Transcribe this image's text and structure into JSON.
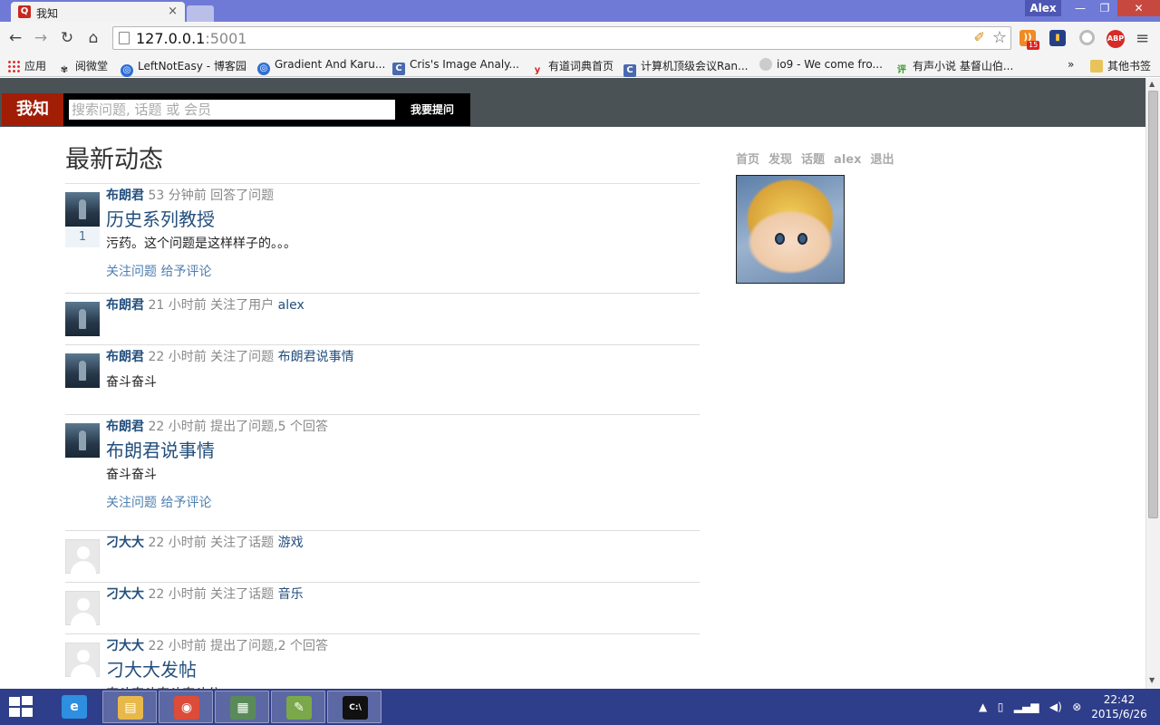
{
  "browser": {
    "tab_title": "我知",
    "tab_favicon": "Q",
    "profile_name": "Alex",
    "url_host": "127.0.0.1",
    "url_port": ":5001",
    "rss_count": "15",
    "abp_label": "ABP"
  },
  "bookmarks": [
    {
      "label": "应用",
      "icon": "apps-grid-icon"
    },
    {
      "label": "阅微堂",
      "icon": "ink-icon"
    },
    {
      "label": "LeftNotEasy - 博客园",
      "icon": "globe-icon"
    },
    {
      "label": "Gradient And Karu...",
      "icon": "globe-icon"
    },
    {
      "label": "Cris's Image Analy...",
      "icon": "c-icon"
    },
    {
      "label": "有道词典首页",
      "icon": "y-icon"
    },
    {
      "label": "计算机顶级会议Ran...",
      "icon": "c-icon"
    },
    {
      "label": "io9 - We come fro...",
      "icon": "io9-icon"
    },
    {
      "label": "有声小说 基督山伯...",
      "icon": "ping-icon"
    },
    {
      "label": "»",
      "icon": ""
    },
    {
      "label": "其他书签",
      "icon": "folder-icon"
    }
  ],
  "site": {
    "logo": "我知",
    "search_placeholder": "搜索问题, 话题 或 会员",
    "ask_button": "我要提问"
  },
  "feed": {
    "title": "最新动态",
    "items": [
      {
        "user": "布朗君",
        "meta": " 53 分钟前 回答了问题",
        "object": "",
        "title": "历史系列教授",
        "body": "污药。这个问题是这样样子的。。。",
        "votes": "1",
        "actions": [
          "关注问题",
          "给予评论"
        ],
        "avatar": "photo"
      },
      {
        "user": "布朗君",
        "meta": " 21 小时前 关注了用户 ",
        "object": "alex",
        "title": "",
        "body": "",
        "votes": "",
        "actions": [],
        "avatar": "photo"
      },
      {
        "user": "布朗君",
        "meta": " 22 小时前 关注了问题 ",
        "object": "布朗君说事情",
        "title": "",
        "body": "奋斗奋斗",
        "votes": "",
        "actions": [],
        "avatar": "photo"
      },
      {
        "user": "布朗君",
        "meta": " 22 小时前 提出了问题,5 个回答",
        "object": "",
        "title": "布朗君说事情",
        "body": "奋斗奋斗",
        "votes": "",
        "actions": [
          "关注问题",
          "给予评论"
        ],
        "avatar": "photo"
      },
      {
        "user": "刁大大",
        "meta": " 22 小时前 关注了话题 ",
        "object": "游戏",
        "title": "",
        "body": "",
        "votes": "",
        "actions": [],
        "avatar": "blank"
      },
      {
        "user": "刁大大",
        "meta": " 22 小时前 关注了话题 ",
        "object": "音乐",
        "title": "",
        "body": "",
        "votes": "",
        "actions": [],
        "avatar": "blank"
      },
      {
        "user": "刁大大",
        "meta": " 22 小时前 提出了问题,2 个回答",
        "object": "",
        "title": "刁大大发帖",
        "body": "奋斗奋斗奋斗奋斗分",
        "votes": "",
        "actions": [],
        "avatar": "blank"
      }
    ]
  },
  "sidebar": {
    "nav": [
      "首页",
      "发现",
      "话题",
      "alex",
      "退出"
    ]
  },
  "taskbar": {
    "apps": [
      {
        "name": "ie",
        "glyph": "e",
        "color": "#2e8fe0",
        "open": false
      },
      {
        "name": "explorer",
        "glyph": "▤",
        "color": "#e8b84a",
        "open": true
      },
      {
        "name": "chrome",
        "glyph": "◉",
        "color": "#dd4b39",
        "open": true
      },
      {
        "name": "reader",
        "glyph": "▦",
        "color": "#5a8a5a",
        "open": true
      },
      {
        "name": "notepad",
        "glyph": "✎",
        "color": "#7aa84a",
        "open": true
      },
      {
        "name": "cmd",
        "glyph": "C:\\",
        "color": "#111111",
        "open": true
      }
    ],
    "time": "22:42",
    "date": "2015/6/26"
  }
}
